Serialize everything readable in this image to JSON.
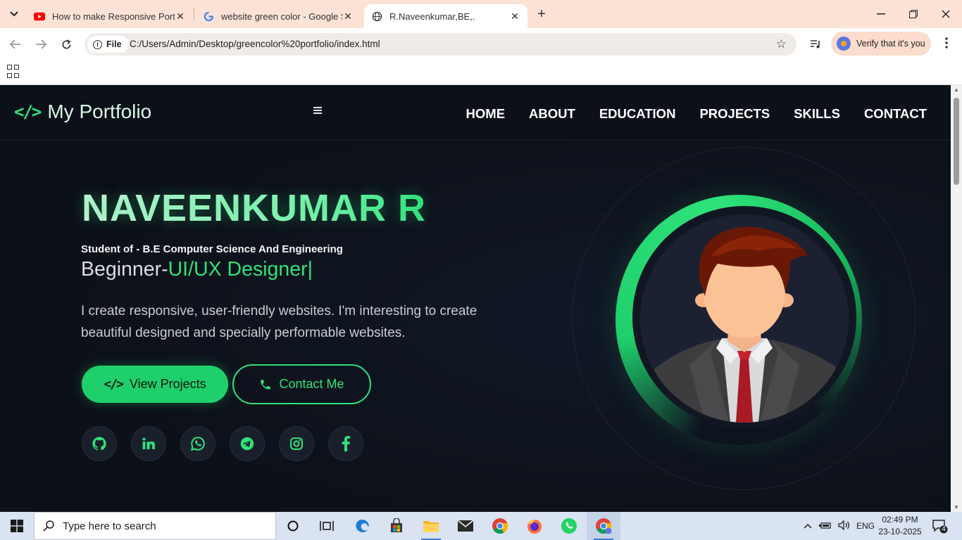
{
  "browser": {
    "tabs": [
      {
        "title": "How to make Responsive Portfolio",
        "favicon": "youtube-icon",
        "active": false
      },
      {
        "title": "website green color - Google Search",
        "favicon": "google-icon",
        "active": false
      },
      {
        "title": "R.Naveenkumar,BE,.",
        "favicon": "globe-icon",
        "active": true
      }
    ],
    "address_chip": "File",
    "url": "C:/Users/Admin/Desktop/greencolor%20portfolio/index.html",
    "verify_label": "Verify that it's you"
  },
  "site": {
    "logo_text": "My Portfolio",
    "logo_symbol": "</>",
    "menu": [
      "HOME",
      "ABOUT",
      "EDUCATION",
      "PROJECTS",
      "SKILLS",
      "CONTACT"
    ],
    "hero": {
      "name": "NAVEENKUMAR R",
      "student_line": "Student of - B.E Computer Science And Engineering",
      "role_prefix": "Beginner-",
      "role_accent": "UI/UX Designer",
      "role_cursor": "|",
      "description": "I create responsive, user-friendly websites. I'm interesting to create beautiful designed and specially performable websites.",
      "primary_button": "View Projects",
      "secondary_button": "Contact Me"
    },
    "socials": [
      "github-icon",
      "linkedin-icon",
      "whatsapp-icon",
      "telegram-icon",
      "instagram-icon",
      "facebook-icon"
    ],
    "accent_color": "#2ee27a",
    "background_color": "#0d1117"
  },
  "taskbar": {
    "search_placeholder": "Type here to search",
    "language": "ENG",
    "time": "02:49 PM",
    "date": "23-10-2025",
    "notification_count": "4"
  }
}
